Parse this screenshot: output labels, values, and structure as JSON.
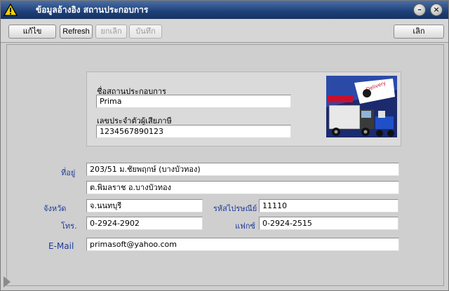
{
  "window": {
    "title": "ข้อมูลอ้างอิง สถานประกอบการ"
  },
  "toolbar": {
    "edit_label": "แก้ไข",
    "refresh_label": "Refresh",
    "cancel_label": "ยกเลิก",
    "save_label": "บันทึก",
    "exit_label": "เลิก"
  },
  "company": {
    "name_label": "ชื่อสถานประกอบการ",
    "name_value": "Prima",
    "tax_label": "เลขประจำตัวผู้เสียภาษี",
    "tax_value": "1234567890123",
    "logo_text": "Delivery"
  },
  "address": {
    "label": "ที่อยู่",
    "line1": "203/51 ม.ชัยพฤกษ์ (บางบัวทอง)",
    "line2": "ต.พิมลราช  อ.บางบัวทอง",
    "province_label": "จังหวัด",
    "province_value": "จ.นนทบุรี",
    "postal_label": "รหัสไปรษณีย์",
    "postal_value": "11110",
    "phone_label": "โทร.",
    "phone_value": "0-2924-2902",
    "fax_label": "แฟกซ์",
    "fax_value": "0-2924-2515",
    "email_label": "E-Mail",
    "email_value": "primasoft@yahoo.com"
  },
  "colors": {
    "titlebar": "#1d3f78",
    "label_blue": "#1e3a9a"
  }
}
